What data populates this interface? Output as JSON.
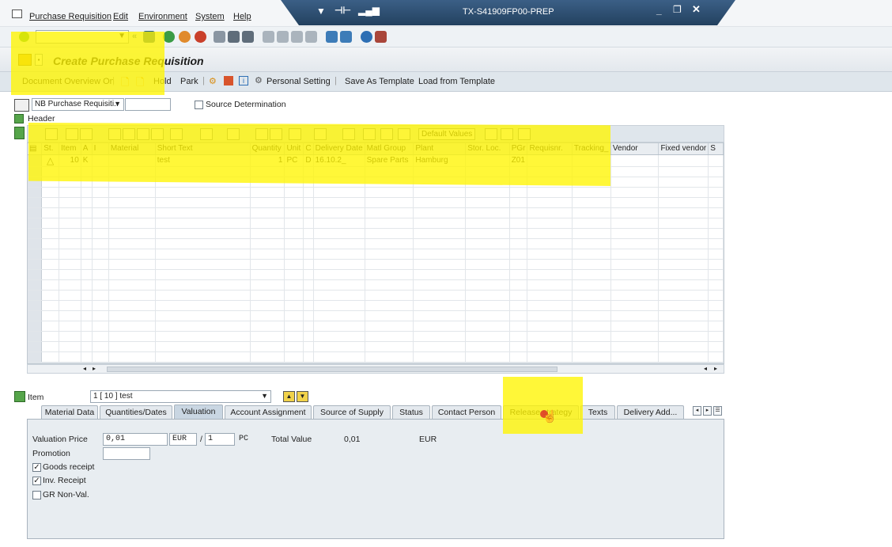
{
  "menu": {
    "items": [
      "Purchase Requisition",
      "Edit",
      "Environment",
      "System",
      "Help"
    ],
    "system_id": "TX-S41909FP00-PREP"
  },
  "toolbar": {
    "command_field": "",
    "icons": [
      "enter-icon",
      "back-icon",
      "save-icon",
      "back-arrow-icon",
      "exit-icon",
      "cancel-icon",
      "print-icon",
      "find-icon",
      "find-next-icon",
      "first-page-icon",
      "prev-page-icon",
      "next-page-icon",
      "last-page-icon",
      "new-session-icon",
      "shortcut-icon",
      "help-icon",
      "layout-icon"
    ]
  },
  "page": {
    "title": "Create Purchase Requisition"
  },
  "app_toolbar": {
    "document_overview": "Document Overview On",
    "hold": "Hold",
    "park": "Park",
    "personal_setting": "Personal Setting",
    "save_as_template": "Save As Template",
    "load_from_template": "Load from Template"
  },
  "header": {
    "doc_type": "NB Purchase Requisiti..",
    "doc_number": "",
    "source_determination": "Source Determination",
    "header_label": "Header"
  },
  "grid_toolbar": {
    "default_values": "Default Values"
  },
  "grid": {
    "columns": [
      "St.",
      "Item",
      "A",
      "I",
      "Material",
      "Short Text",
      "Quantity",
      "Unit",
      "C",
      "Delivery Date",
      "Matl Group",
      "Plant",
      "Stor. Loc.",
      "PGr",
      "Requisnr.",
      "Tracking_",
      "Vendor",
      "Fixed vendor",
      "S"
    ],
    "rows": [
      [
        "△",
        "10",
        "K",
        "",
        "",
        "test",
        "1",
        "PC",
        "D",
        "16.10.2_",
        "Spare Parts",
        "Hamburg",
        "",
        "Z01",
        "",
        "",
        "",
        "",
        ""
      ]
    ]
  },
  "item": {
    "label": "Item",
    "selector": "1 [ 10 ] test"
  },
  "tabs": [
    "Material Data",
    "Quantities/Dates",
    "Valuation",
    "Account Assignment",
    "Source of Supply",
    "Status",
    "Contact Person",
    "Release strategy",
    "Texts",
    "Delivery Add..."
  ],
  "active_tab": "Valuation",
  "valuation": {
    "valuation_price_label": "Valuation Price",
    "valuation_price": "0,01",
    "currency": "EUR",
    "per": "1",
    "unit": "PC",
    "total_value_label": "Total Value",
    "total_value": "0,01",
    "total_currency": "EUR",
    "promotion_label": "Promotion",
    "promotion": "",
    "goods_receipt_label": "Goods receipt",
    "goods_receipt": true,
    "inv_receipt_label": "Inv. Receipt",
    "inv_receipt": true,
    "gr_non_val_label": "GR Non-Val.",
    "gr_non_val": false
  },
  "colors": {
    "highlight": "#fff500",
    "title_banner": "#2e4e70"
  }
}
